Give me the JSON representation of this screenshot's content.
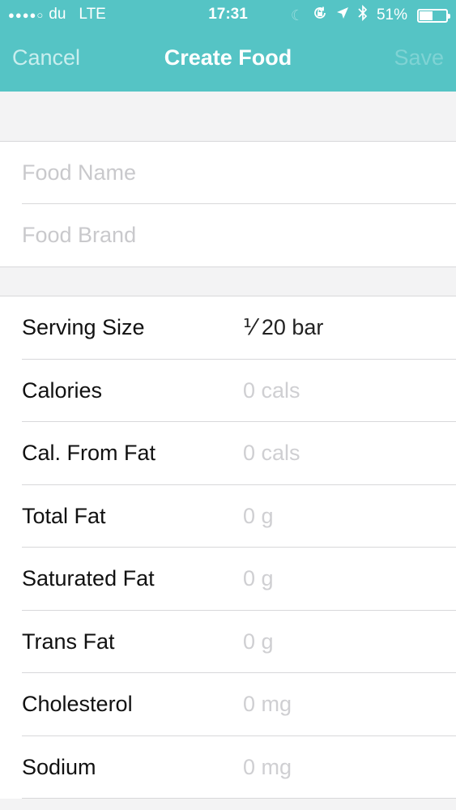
{
  "status_bar": {
    "signal_dots": "●●●●○",
    "carrier": "du",
    "network": "LTE",
    "time": "17:31",
    "icons": [
      "moon-icon",
      "rotation-lock-icon",
      "location-arrow-icon",
      "bluetooth-icon"
    ],
    "battery_percent": "51%",
    "battery_level": 0.51
  },
  "nav": {
    "cancel_label": "Cancel",
    "title": "Create Food",
    "save_label": "Save"
  },
  "food_info": {
    "name_placeholder": "Food Name",
    "brand_placeholder": "Food Brand"
  },
  "nutrition": [
    {
      "label": "Serving Size",
      "value": "⅟ 20 bar",
      "filled": true
    },
    {
      "label": "Calories",
      "value": "0 cals",
      "filled": false
    },
    {
      "label": "Cal. From Fat",
      "value": "0 cals",
      "filled": false
    },
    {
      "label": "Total Fat",
      "value": "0 g",
      "filled": false
    },
    {
      "label": "Saturated Fat",
      "value": "0 g",
      "filled": false
    },
    {
      "label": "Trans Fat",
      "value": "0 g",
      "filled": false
    },
    {
      "label": "Cholesterol",
      "value": "0 mg",
      "filled": false
    },
    {
      "label": "Sodium",
      "value": "0 mg",
      "filled": false
    }
  ],
  "colors": {
    "accent": "#55c4c5",
    "placeholder": "#c9c9cc",
    "separator": "#d8d8da"
  }
}
